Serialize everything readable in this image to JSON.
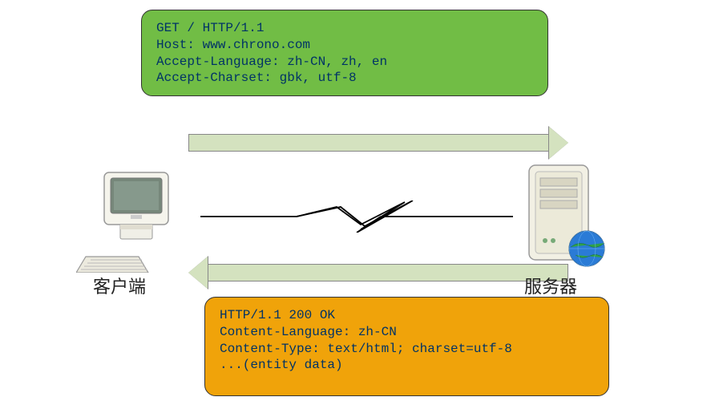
{
  "request": {
    "lines": [
      "GET / HTTP/1.1",
      "Host: www.chrono.com",
      "Accept-Language: zh-CN, zh, en",
      "Accept-Charset: gbk, utf-8"
    ]
  },
  "response": {
    "lines": [
      "HTTP/1.1 200 OK",
      "Content-Language: zh-CN",
      "Content-Type: text/html; charset=utf-8",
      "",
      "...(entity data)"
    ]
  },
  "labels": {
    "client": "客户端",
    "server": "服务器"
  }
}
